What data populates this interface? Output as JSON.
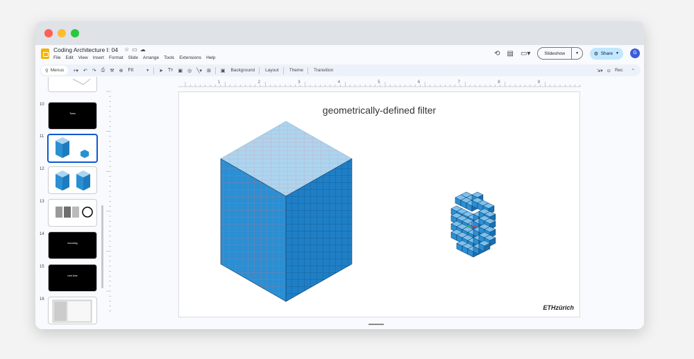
{
  "app": {
    "doc_title": "Coding Architecture I: 04",
    "menus": [
      "File",
      "Edit",
      "View",
      "Insert",
      "Format",
      "Slide",
      "Arrange",
      "Tools",
      "Extensions",
      "Help"
    ],
    "slideshow_label": "Slideshow",
    "share_label": "Share",
    "avatar_letter": "G"
  },
  "toolbar": {
    "search_label": "Menus",
    "zoom_label": "Fit",
    "background_label": "Background",
    "layout_label": "Layout",
    "theme_label": "Theme",
    "transition_label": "Transition",
    "rec_label": "Rec"
  },
  "filmstrip": {
    "slides": [
      {
        "num": "10",
        "text": "Trees",
        "dark": true
      },
      {
        "num": "11",
        "text": "",
        "dark": false,
        "selected": true
      },
      {
        "num": "12",
        "text": "",
        "dark": false
      },
      {
        "num": "13",
        "text": "",
        "dark": false
      },
      {
        "num": "14",
        "text": "encoding",
        "dark": true
      },
      {
        "num": "15",
        "text": "next time",
        "dark": true
      },
      {
        "num": "16",
        "text": "",
        "dark": false
      }
    ]
  },
  "ruler": {
    "h_labels": [
      "1",
      "2",
      "3",
      "4",
      "5",
      "6",
      "7",
      "8",
      "9"
    ],
    "v_labels": [
      "1",
      "2",
      "3",
      "4",
      "5"
    ]
  },
  "slide": {
    "title": "geometrically-defined filter",
    "logo": "ETHzürich",
    "colors": {
      "cube_top": "#acd4ef",
      "cube_side": "#2a8fd3",
      "grid": "#e0707a"
    }
  }
}
